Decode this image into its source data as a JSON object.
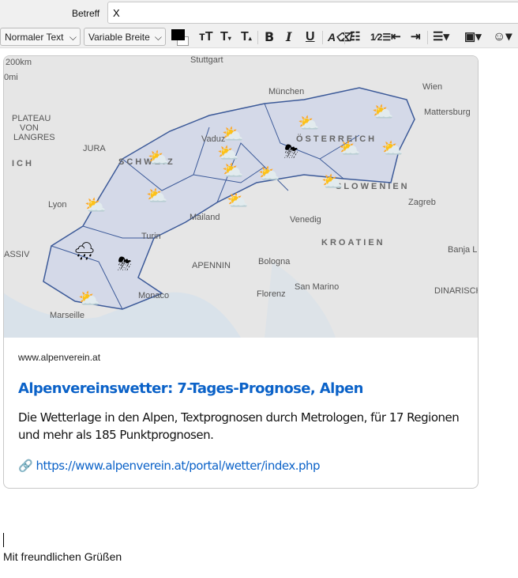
{
  "header": {
    "subject_label": "Betreff",
    "subject_value": "X"
  },
  "toolbar": {
    "paragraph_format": "Normaler Text",
    "font": "Variable Breite",
    "text_color": "#000000",
    "background_color": "#ffffff",
    "buttons": [
      "font-size-smaller",
      "font-size-larger-small",
      "font-size-larger",
      "bold",
      "italic",
      "underline",
      "remove-formatting",
      "bulleted-list",
      "numbered-list",
      "outdent",
      "indent",
      "align",
      "insert-image",
      "insert-emoji"
    ]
  },
  "card": {
    "map": {
      "scale_km": "200km",
      "scale_mi": "0mi",
      "labels": [
        "Stuttgart",
        "München",
        "Wien",
        "Mattersburg",
        "PLATEAU",
        "VON",
        "LANGRES",
        "ICH",
        "JURA",
        "SCHWEIZ",
        "Vaduz",
        "ÖSTERREICH",
        "SLOWENIEN",
        "Zagreb",
        "Lyon",
        "Mailand",
        "Venedig",
        "Turin",
        "KROATIEN",
        "ASSIV",
        "Bologna",
        "APENNIN",
        "San Marino",
        "Banja L",
        "Monaco",
        "Florenz",
        "Marseille",
        "DINARISCHES"
      ]
    },
    "site": "www.alpenverein.at",
    "title": "Alpenvereinswetter: 7-Tages-Prognose, Alpen",
    "description": "Die Wetterlage in den Alpen, Textprognosen durch Metrologen, für 17 Regionen und mehr als 185 Punktprognosen.",
    "url": "https://www.alpenverein.at/portal/wetter/index.php"
  },
  "body": {
    "signature": "Mit freundlichen Grüßen"
  }
}
